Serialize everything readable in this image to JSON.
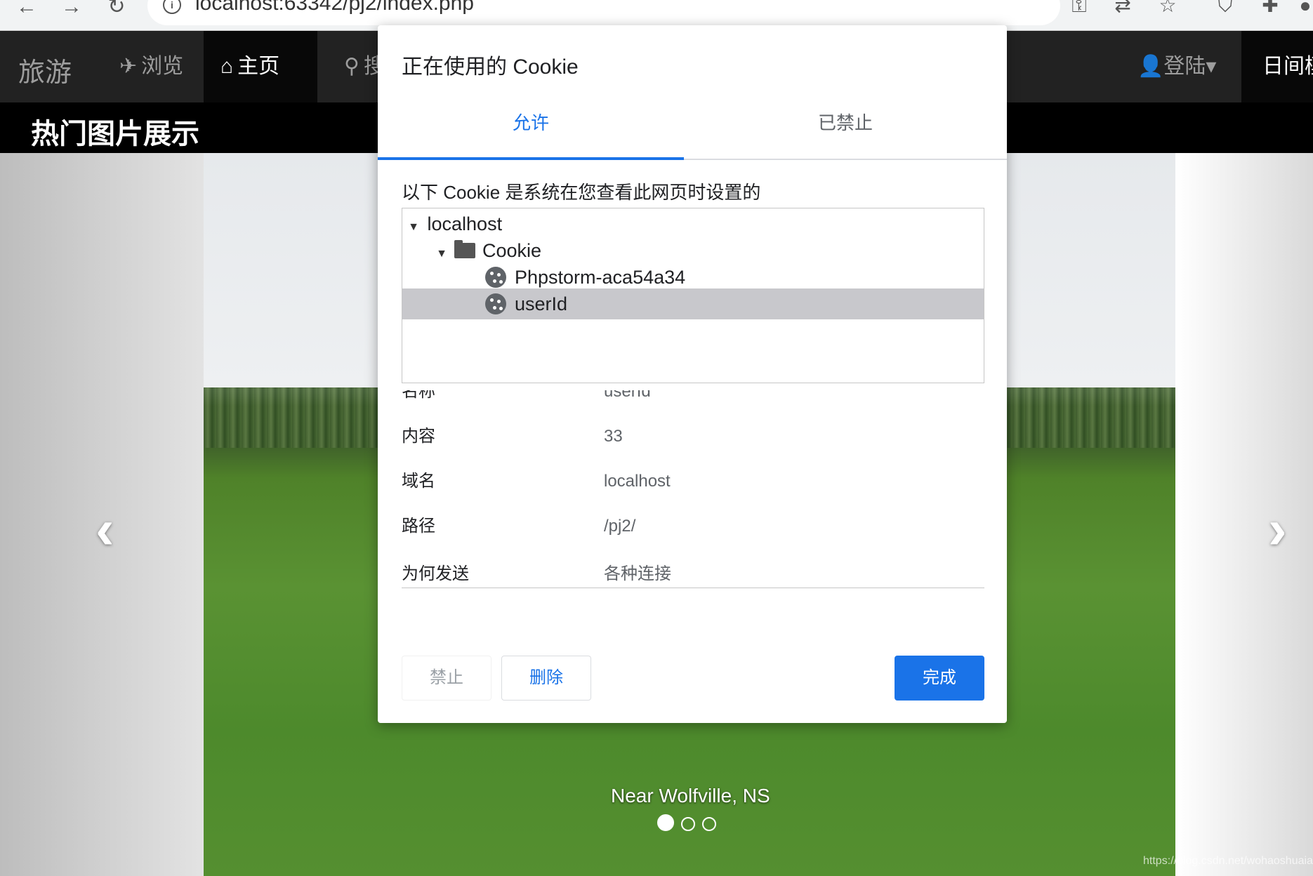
{
  "browser": {
    "url": "localhost:63342/pj2/index.php",
    "back_glyph": "←",
    "forward_glyph": "→",
    "reload_glyph": "↻",
    "info_glyph": "i",
    "tools": [
      {
        "name": "key-icon",
        "glyph": "⚿"
      },
      {
        "name": "translate-icon",
        "glyph": "⇄"
      },
      {
        "name": "star-icon",
        "glyph": "☆"
      },
      {
        "name": "shield-icon",
        "glyph": "⛉"
      },
      {
        "name": "puzzle-icon",
        "glyph": "✚"
      },
      {
        "name": "profile-icon",
        "glyph": "●"
      }
    ]
  },
  "site": {
    "brand": "旅游",
    "nav": [
      {
        "label": "浏览",
        "glyph": "✈",
        "active": false
      },
      {
        "label": "主页",
        "glyph": "⌂",
        "active": true
      },
      {
        "label": "搜索",
        "glyph": "⚲",
        "active": false
      }
    ],
    "login": "登陆",
    "login_glyph": "👤",
    "night_mode": "日间模式",
    "section_title": "热门图片展示"
  },
  "carousel": {
    "caption": "Near Wolfville, NS",
    "prev_glyph": "‹",
    "next_glyph": "›",
    "slide_count": 3,
    "active_index": 0,
    "watermark": "https://blog.csdn.net/wohaoshuaia"
  },
  "dialog": {
    "title": "正在使用的 Cookie",
    "tabs": [
      {
        "label": "允许",
        "active": true
      },
      {
        "label": "已禁止",
        "active": false
      }
    ],
    "description": "以下 Cookie 是系统在您查看此网页时设置的",
    "tree": {
      "host": "localhost",
      "folder": "Cookie",
      "cookies": [
        {
          "name": "Phpstorm-aca54a34",
          "selected": false
        },
        {
          "name": "userId",
          "selected": true
        }
      ]
    },
    "details": [
      {
        "label": "名称",
        "value": "userId"
      },
      {
        "label": "内容",
        "value": "33"
      },
      {
        "label": "域名",
        "value": "localhost"
      },
      {
        "label": "路径",
        "value": "/pj2/"
      },
      {
        "label": "为何发送",
        "value": "各种连接"
      }
    ],
    "buttons": {
      "block": "禁止",
      "delete": "删除",
      "done": "完成"
    }
  },
  "colors": {
    "accent": "#1a73e8",
    "navbar": "#222222",
    "selected_row": "#c8c8cc"
  }
}
